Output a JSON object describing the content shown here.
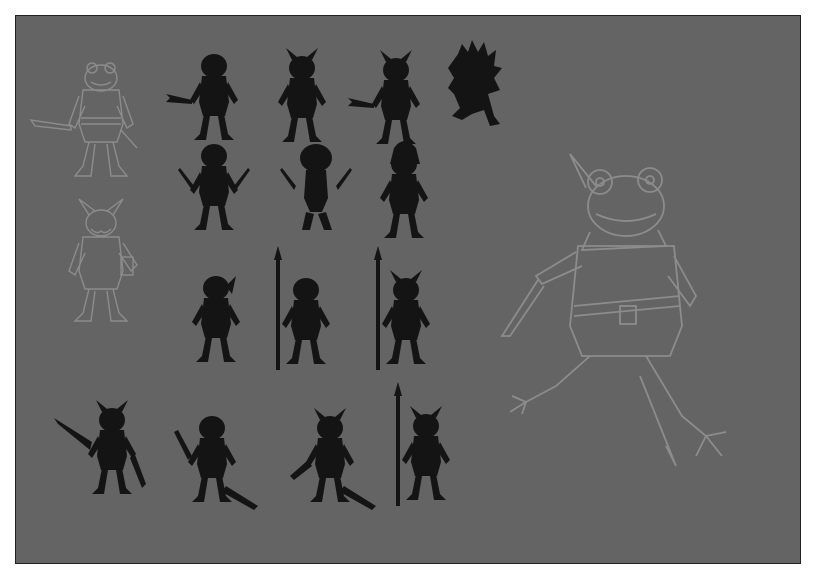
{
  "sheet": {
    "background": "#646464",
    "silhouette_color": "#141414",
    "sketch_line_color": "#8c8c8c"
  },
  "sketches": [
    {
      "kind": "frog-adventurer-sketch"
    },
    {
      "kind": "horned-frog-sketch"
    },
    {
      "kind": "large-frog-rogue-sketch"
    }
  ],
  "silhouettes": [
    {
      "kind": "dagger-pose"
    },
    {
      "kind": "horned-pose"
    },
    {
      "kind": "horned-dagger-pose"
    },
    {
      "kind": "spiky-crouch"
    },
    {
      "kind": "twin-dagger-pose"
    },
    {
      "kind": "round-head-twin-dagger-pose"
    },
    {
      "kind": "hooded-pose"
    },
    {
      "kind": "hunched-pose"
    },
    {
      "kind": "spear-pose"
    },
    {
      "kind": "spear-pose"
    },
    {
      "kind": "lunge-pose"
    },
    {
      "kind": "crouch-blade-pose"
    },
    {
      "kind": "horned-crouch-pose"
    },
    {
      "kind": "spear-horned-pose"
    }
  ]
}
